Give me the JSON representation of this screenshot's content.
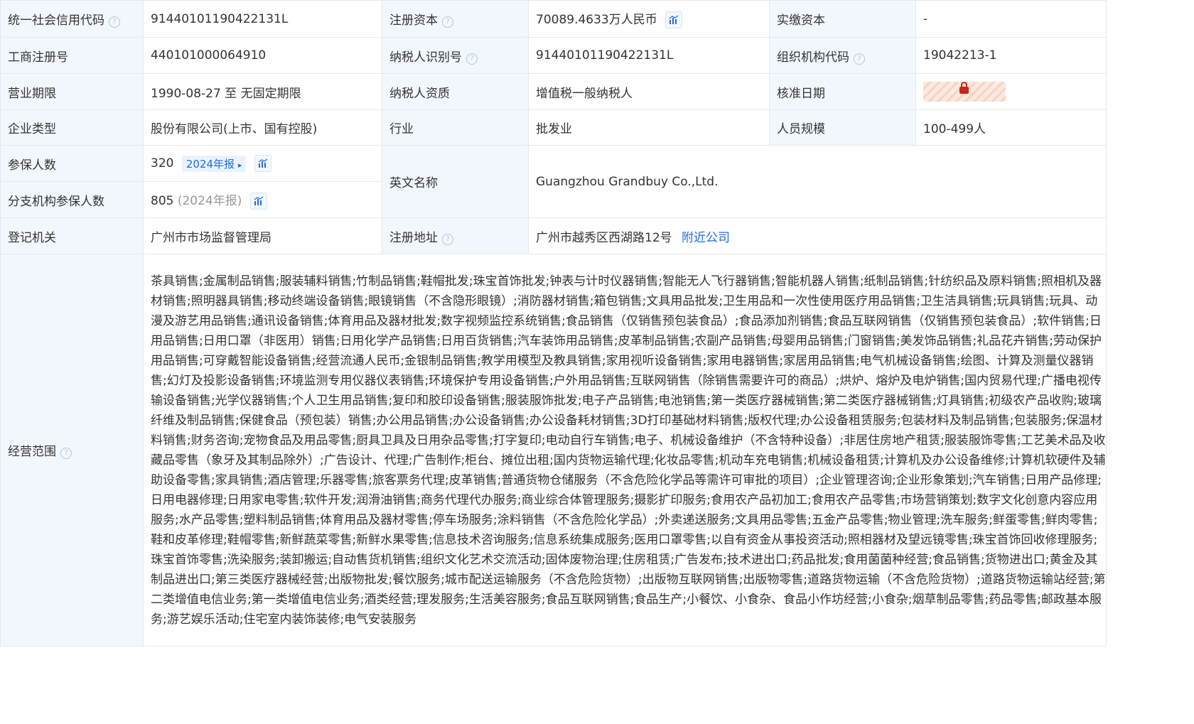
{
  "rows": {
    "r1": {
      "l1": "统一社会信用代码",
      "v1": "91440101190422131L",
      "l2": "注册资本",
      "v2": "70089.4633万人民币",
      "l3": "实缴资本",
      "v3": "-"
    },
    "r2": {
      "l1": "工商注册号",
      "v1": "440101000064910",
      "l2": "纳税人识别号",
      "v2": "91440101190422131L",
      "l3": "组织机构代码",
      "v3": "19042213-1"
    },
    "r3": {
      "l1": "营业期限",
      "v1": "1990-08-27 至 无固定期限",
      "l2": "纳税人资质",
      "v2": "增值税一般纳税人",
      "l3": "核准日期"
    },
    "r4": {
      "l1": "企业类型",
      "v1": "股份有限公司(上市、国有控股)",
      "l2": "行业",
      "v2": "批发业",
      "l3": "人员规模",
      "v3": "100-499人"
    },
    "r5": {
      "l1": "参保人数",
      "v1": "320",
      "tag": "2024年报",
      "tag_arrow": "▸",
      "l2": "英文名称",
      "v2": "Guangzhou Grandbuy Co.,Ltd."
    },
    "r6": {
      "l1": "分支机构参保人数",
      "v1": "805",
      "v1_note": "(2024年报)"
    },
    "r7": {
      "l1": "登记机关",
      "v1": "广州市市场监督管理局",
      "l2": "注册地址",
      "v2": "广州市越秀区西湖路12号",
      "link": "附近公司"
    },
    "r8": {
      "l1": "经营范围",
      "scope": "茶具销售;金属制品销售;服装辅料销售;竹制品销售;鞋帽批发;珠宝首饰批发;钟表与计时仪器销售;智能无人飞行器销售;智能机器人销售;纸制品销售;针纺织品及原料销售;照相机及器材销售;照明器具销售;移动终端设备销售;眼镜销售（不含隐形眼镜）;消防器材销售;箱包销售;文具用品批发;卫生用品和一次性使用医疗用品销售;卫生洁具销售;玩具销售;玩具、动漫及游艺用品销售;通讯设备销售;体育用品及器材批发;数字视频监控系统销售;食品销售（仅销售预包装食品）;食品添加剂销售;食品互联网销售（仅销售预包装食品）;软件销售;日用品销售;日用口罩（非医用）销售;日用化学产品销售;日用百货销售;汽车装饰用品销售;皮革制品销售;农副产品销售;母婴用品销售;门窗销售;美发饰品销售;礼品花卉销售;劳动保护用品销售;可穿戴智能设备销售;经营流通人民币;金银制品销售;教学用模型及教具销售;家用视听设备销售;家用电器销售;家居用品销售;电气机械设备销售;绘图、计算及测量仪器销售;幻灯及投影设备销售;环境监测专用仪器仪表销售;环境保护专用设备销售;户外用品销售;互联网销售（除销售需要许可的商品）;烘炉、熔炉及电炉销售;国内贸易代理;广播电视传输设备销售;光学仪器销售;个人卫生用品销售;复印和胶印设备销售;服装服饰批发;电子产品销售;电池销售;第一类医疗器械销售;第二类医疗器械销售;灯具销售;初级农产品收购;玻璃纤维及制品销售;保健食品（预包装）销售;办公用品销售;办公设备销售;办公设备耗材销售;3D打印基础材料销售;版权代理;办公设备租赁服务;包装材料及制品销售;包装服务;保温材料销售;财务咨询;宠物食品及用品零售;厨具卫具及日用杂品零售;打字复印;电动自行车销售;电子、机械设备维护（不含特种设备）;非居住房地产租赁;服装服饰零售;工艺美术品及收藏品零售（象牙及其制品除外）;广告设计、代理;广告制作;柜台、摊位出租;国内货物运输代理;化妆品零售;机动车充电销售;机械设备租赁;计算机及办公设备维修;计算机软硬件及辅助设备零售;家具销售;酒店管理;乐器零售;旅客票务代理;皮革销售;普通货物仓储服务（不含危险化学品等需许可审批的项目）;企业管理咨询;企业形象策划;汽车销售;日用产品修理;日用电器修理;日用家电零售;软件开发;润滑油销售;商务代理代办服务;商业综合体管理服务;摄影扩印服务;食用农产品初加工;食用农产品零售;市场营销策划;数字文化创意内容应用服务;水产品零售;塑料制品销售;体育用品及器材零售;停车场服务;涂料销售（不含危险化学品）;外卖递送服务;文具用品零售;五金产品零售;物业管理;洗车服务;鲜蛋零售;鲜肉零售;鞋和皮革修理;鞋帽零售;新鲜蔬菜零售;新鲜水果零售;信息技术咨询服务;信息系统集成服务;医用口罩零售;以自有资金从事投资活动;照相器材及望远镜零售;珠宝首饰回收修理服务;珠宝首饰零售;洗染服务;装卸搬运;自动售货机销售;组织文化艺术交流活动;固体废物治理;住房租赁;广告发布;技术进出口;药品批发;食用菌菌种经营;食品销售;货物进出口;黄金及其制品进出口;第三类医疗器械经营;出版物批发;餐饮服务;城市配送运输服务（不含危险货物）;出版物互联网销售;出版物零售;道路货物运输（不含危险货物）;道路货物运输站经营;第二类增值电信业务;第一类增值电信业务;酒类经营;理发服务;生活美容服务;食品互联网销售;食品生产;小餐饮、小食杂、食品小作坊经营;小食杂;烟草制品零售;药品零售;邮政基本服务;游艺娱乐活动;住宅室内装饰装修;电气安装服务"
    }
  },
  "icons": {
    "help": "question-circle-icon",
    "chart": "bar-chart-icon",
    "lock": "lock-icon"
  },
  "colors": {
    "label_bg": "#f2f7fd",
    "link": "#1f6bd6",
    "border": "#e4e8ef",
    "lock": "#c8271d"
  }
}
